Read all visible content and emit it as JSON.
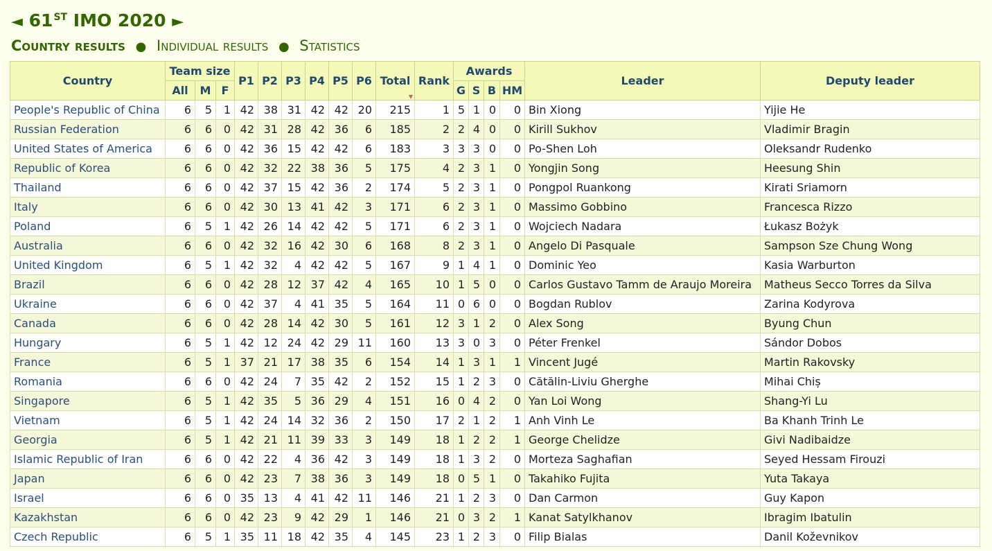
{
  "header": {
    "title_prefix": "◄",
    "title_num": "61",
    "title_sup": "ST",
    "title_rest": "IMO 2020",
    "title_suffix": "►"
  },
  "nav": {
    "country_results": "Country results",
    "individual_results": "Individual results",
    "statistics": "Statistics",
    "separator": "●"
  },
  "columns": {
    "country": "Country",
    "team_size": "Team size",
    "all": "All",
    "m": "M",
    "f": "F",
    "p1": "P1",
    "p2": "P2",
    "p3": "P3",
    "p4": "P4",
    "p5": "P5",
    "p6": "P6",
    "total": "Total",
    "rank": "Rank",
    "awards": "Awards",
    "g": "G",
    "s": "S",
    "b": "B",
    "hm": "HM",
    "leader": "Leader",
    "deputy": "Deputy leader"
  },
  "rows": [
    [
      "People's Republic of China",
      "6",
      "5",
      "1",
      "42",
      "38",
      "31",
      "42",
      "42",
      "20",
      "215",
      "1",
      "5",
      "1",
      "0",
      "0",
      "Bin Xiong",
      "Yijie He"
    ],
    [
      "Russian Federation",
      "6",
      "6",
      "0",
      "42",
      "31",
      "28",
      "42",
      "36",
      "6",
      "185",
      "2",
      "2",
      "4",
      "0",
      "0",
      "Kirill Sukhov",
      "Vladimir Bragin"
    ],
    [
      "United States of America",
      "6",
      "6",
      "0",
      "42",
      "36",
      "15",
      "42",
      "42",
      "6",
      "183",
      "3",
      "3",
      "3",
      "0",
      "0",
      "Po-Shen Loh",
      "Oleksandr Rudenko"
    ],
    [
      "Republic of Korea",
      "6",
      "6",
      "0",
      "42",
      "32",
      "22",
      "38",
      "36",
      "5",
      "175",
      "4",
      "2",
      "3",
      "1",
      "0",
      "Yongjin Song",
      "Heesung Shin"
    ],
    [
      "Thailand",
      "6",
      "6",
      "0",
      "42",
      "37",
      "15",
      "42",
      "36",
      "2",
      "174",
      "5",
      "2",
      "3",
      "1",
      "0",
      "Pongpol Ruankong",
      "Kirati Sriamorn"
    ],
    [
      "Italy",
      "6",
      "6",
      "0",
      "42",
      "30",
      "13",
      "41",
      "42",
      "3",
      "171",
      "6",
      "2",
      "3",
      "1",
      "0",
      "Massimo Gobbino",
      "Francesca Rizzo"
    ],
    [
      "Poland",
      "6",
      "5",
      "1",
      "42",
      "26",
      "14",
      "42",
      "42",
      "5",
      "171",
      "6",
      "2",
      "3",
      "1",
      "0",
      "Wojciech Nadara",
      "Łukasz Bożyk"
    ],
    [
      "Australia",
      "6",
      "6",
      "0",
      "42",
      "32",
      "16",
      "42",
      "30",
      "6",
      "168",
      "8",
      "2",
      "3",
      "1",
      "0",
      "Angelo Di Pasquale",
      "Sampson Sze Chung Wong"
    ],
    [
      "United Kingdom",
      "6",
      "5",
      "1",
      "42",
      "32",
      "4",
      "42",
      "42",
      "5",
      "167",
      "9",
      "1",
      "4",
      "1",
      "0",
      "Dominic Yeo",
      "Kasia Warburton"
    ],
    [
      "Brazil",
      "6",
      "6",
      "0",
      "42",
      "28",
      "12",
      "37",
      "42",
      "4",
      "165",
      "10",
      "1",
      "5",
      "0",
      "0",
      "Carlos Gustavo Tamm de Araujo Moreira",
      "Matheus Secco Torres da Silva"
    ],
    [
      "Ukraine",
      "6",
      "6",
      "0",
      "42",
      "37",
      "4",
      "41",
      "35",
      "5",
      "164",
      "11",
      "0",
      "6",
      "0",
      "0",
      "Bogdan Rublov",
      "Zarina Kodyrova"
    ],
    [
      "Canada",
      "6",
      "6",
      "0",
      "42",
      "28",
      "14",
      "42",
      "30",
      "5",
      "161",
      "12",
      "3",
      "1",
      "2",
      "0",
      "Alex Song",
      "Byung Chun"
    ],
    [
      "Hungary",
      "6",
      "5",
      "1",
      "42",
      "12",
      "24",
      "42",
      "29",
      "11",
      "160",
      "13",
      "3",
      "0",
      "3",
      "0",
      "Péter Frenkel",
      "Sándor Dobos"
    ],
    [
      "France",
      "6",
      "5",
      "1",
      "37",
      "21",
      "17",
      "38",
      "35",
      "6",
      "154",
      "14",
      "1",
      "3",
      "1",
      "1",
      "Vincent Jugé",
      "Martin Rakovsky"
    ],
    [
      "Romania",
      "6",
      "6",
      "0",
      "42",
      "24",
      "7",
      "35",
      "42",
      "2",
      "152",
      "15",
      "1",
      "2",
      "3",
      "0",
      "Cătălin-Liviu Gherghe",
      "Mihai Chiș"
    ],
    [
      "Singapore",
      "6",
      "5",
      "1",
      "42",
      "35",
      "5",
      "36",
      "29",
      "4",
      "151",
      "16",
      "0",
      "4",
      "2",
      "0",
      "Yan Loi Wong",
      "Shang-Yi Lu"
    ],
    [
      "Vietnam",
      "6",
      "5",
      "1",
      "42",
      "24",
      "14",
      "32",
      "36",
      "2",
      "150",
      "17",
      "2",
      "1",
      "2",
      "1",
      "Anh Vinh Le",
      "Ba Khanh Trinh Le"
    ],
    [
      "Georgia",
      "6",
      "5",
      "1",
      "42",
      "21",
      "11",
      "39",
      "33",
      "3",
      "149",
      "18",
      "1",
      "2",
      "2",
      "1",
      "George Chelidze",
      "Givi Nadibaidze"
    ],
    [
      "Islamic Republic of Iran",
      "6",
      "6",
      "0",
      "42",
      "22",
      "4",
      "36",
      "42",
      "3",
      "149",
      "18",
      "1",
      "3",
      "2",
      "0",
      "Morteza Saghafian",
      "Seyed Hessam Firouzi"
    ],
    [
      "Japan",
      "6",
      "6",
      "0",
      "42",
      "23",
      "7",
      "38",
      "36",
      "3",
      "149",
      "18",
      "0",
      "5",
      "1",
      "0",
      "Takahiko Fujita",
      "Yuta Takaya"
    ],
    [
      "Israel",
      "6",
      "6",
      "0",
      "35",
      "13",
      "4",
      "41",
      "42",
      "11",
      "146",
      "21",
      "1",
      "2",
      "3",
      "0",
      "Dan Carmon",
      "Guy Kapon"
    ],
    [
      "Kazakhstan",
      "6",
      "6",
      "0",
      "42",
      "23",
      "9",
      "42",
      "29",
      "1",
      "146",
      "21",
      "0",
      "3",
      "2",
      "1",
      "Kanat Satylkhanov",
      "Ibragim Ibatulin"
    ],
    [
      "Czech Republic",
      "6",
      "5",
      "1",
      "35",
      "11",
      "18",
      "42",
      "35",
      "4",
      "145",
      "23",
      "1",
      "2",
      "3",
      "0",
      "Filip Bialas",
      "Danil Koževnikov"
    ]
  ]
}
